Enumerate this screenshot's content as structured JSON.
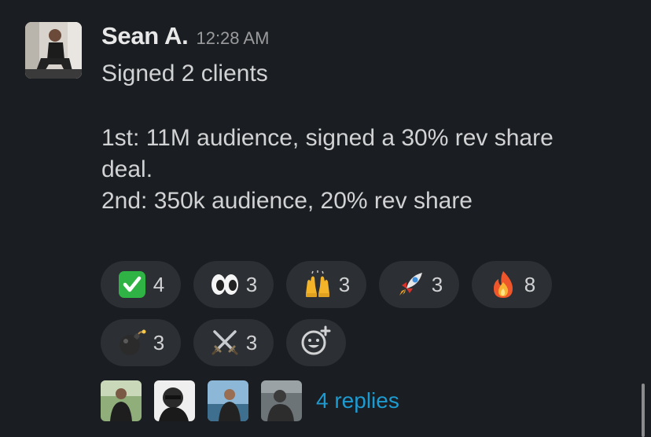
{
  "message": {
    "author": "Sean A.",
    "timestamp": "12:28 AM",
    "lines": {
      "l1": "Signed 2 clients",
      "l2": "1st: 11M audience, signed a 30% rev share",
      "l3": "deal.",
      "l4": "2nd: 350k audience, 20% rev share"
    }
  },
  "reactions": [
    {
      "icon": "check-mark-icon",
      "count": "4"
    },
    {
      "icon": "eyes-icon",
      "count": "3"
    },
    {
      "icon": "raised-hands-icon",
      "count": "3"
    },
    {
      "icon": "rocket-icon",
      "count": "3"
    },
    {
      "icon": "fire-icon",
      "count": "8"
    },
    {
      "icon": "bomb-icon",
      "count": "3"
    },
    {
      "icon": "crossed-swords-icon",
      "count": "3"
    }
  ],
  "add_reaction_icon": "add-reaction-icon",
  "thread": {
    "replies_label": "4 replies"
  },
  "colors": {
    "background": "#1a1d21",
    "pill": "#2c2f33",
    "link": "#1d9bd1",
    "check_green": "#2fb344"
  }
}
